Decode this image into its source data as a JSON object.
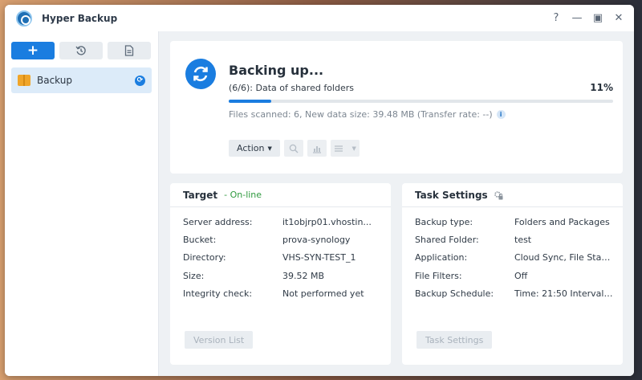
{
  "window": {
    "title": "Hyper Backup",
    "controls": {
      "help": "?",
      "minimize": "—",
      "maximize": "▣",
      "close": "✕"
    }
  },
  "sidebar": {
    "toolbar": {
      "add_label": "+",
      "history_icon": "history-icon",
      "log_icon": "log-icon"
    },
    "tasks": [
      {
        "label": "Backup",
        "status_icon": "sync-icon"
      }
    ]
  },
  "status": {
    "title": "Backing up...",
    "step": "(6/6): Data of shared folders",
    "percent": "11%",
    "progress": 0.11,
    "detail": "Files scanned: 6, New data size: 39.48 MB (Transfer rate: --)",
    "action_label": "Action"
  },
  "target": {
    "title": "Target",
    "status": "- On-line",
    "status_color": "#2f9a3f",
    "rows": [
      {
        "key": "Server address:",
        "value": "it1objrp01.vhostin..."
      },
      {
        "key": "Bucket:",
        "value": "prova-synology"
      },
      {
        "key": "Directory:",
        "value": "VHS-SYN-TEST_1"
      },
      {
        "key": "Size:",
        "value": "39.52 MB"
      },
      {
        "key": "Integrity check:",
        "value": "Not performed yet"
      }
    ],
    "button_label": "Version List"
  },
  "settings": {
    "title": "Task Settings",
    "rows": [
      {
        "key": "Backup type:",
        "value": "Folders and Packages"
      },
      {
        "key": "Shared Folder:",
        "value": "test"
      },
      {
        "key": "Application:",
        "value": "Cloud Sync, File Statio..."
      },
      {
        "key": "File Filters:",
        "value": "Off"
      },
      {
        "key": "Backup Schedule:",
        "value": "Time: 21:50 Interval: ..."
      }
    ],
    "button_label": "Task Settings"
  },
  "colors": {
    "accent": "#1a7de0",
    "sidebar_selected": "#dcebf9"
  }
}
